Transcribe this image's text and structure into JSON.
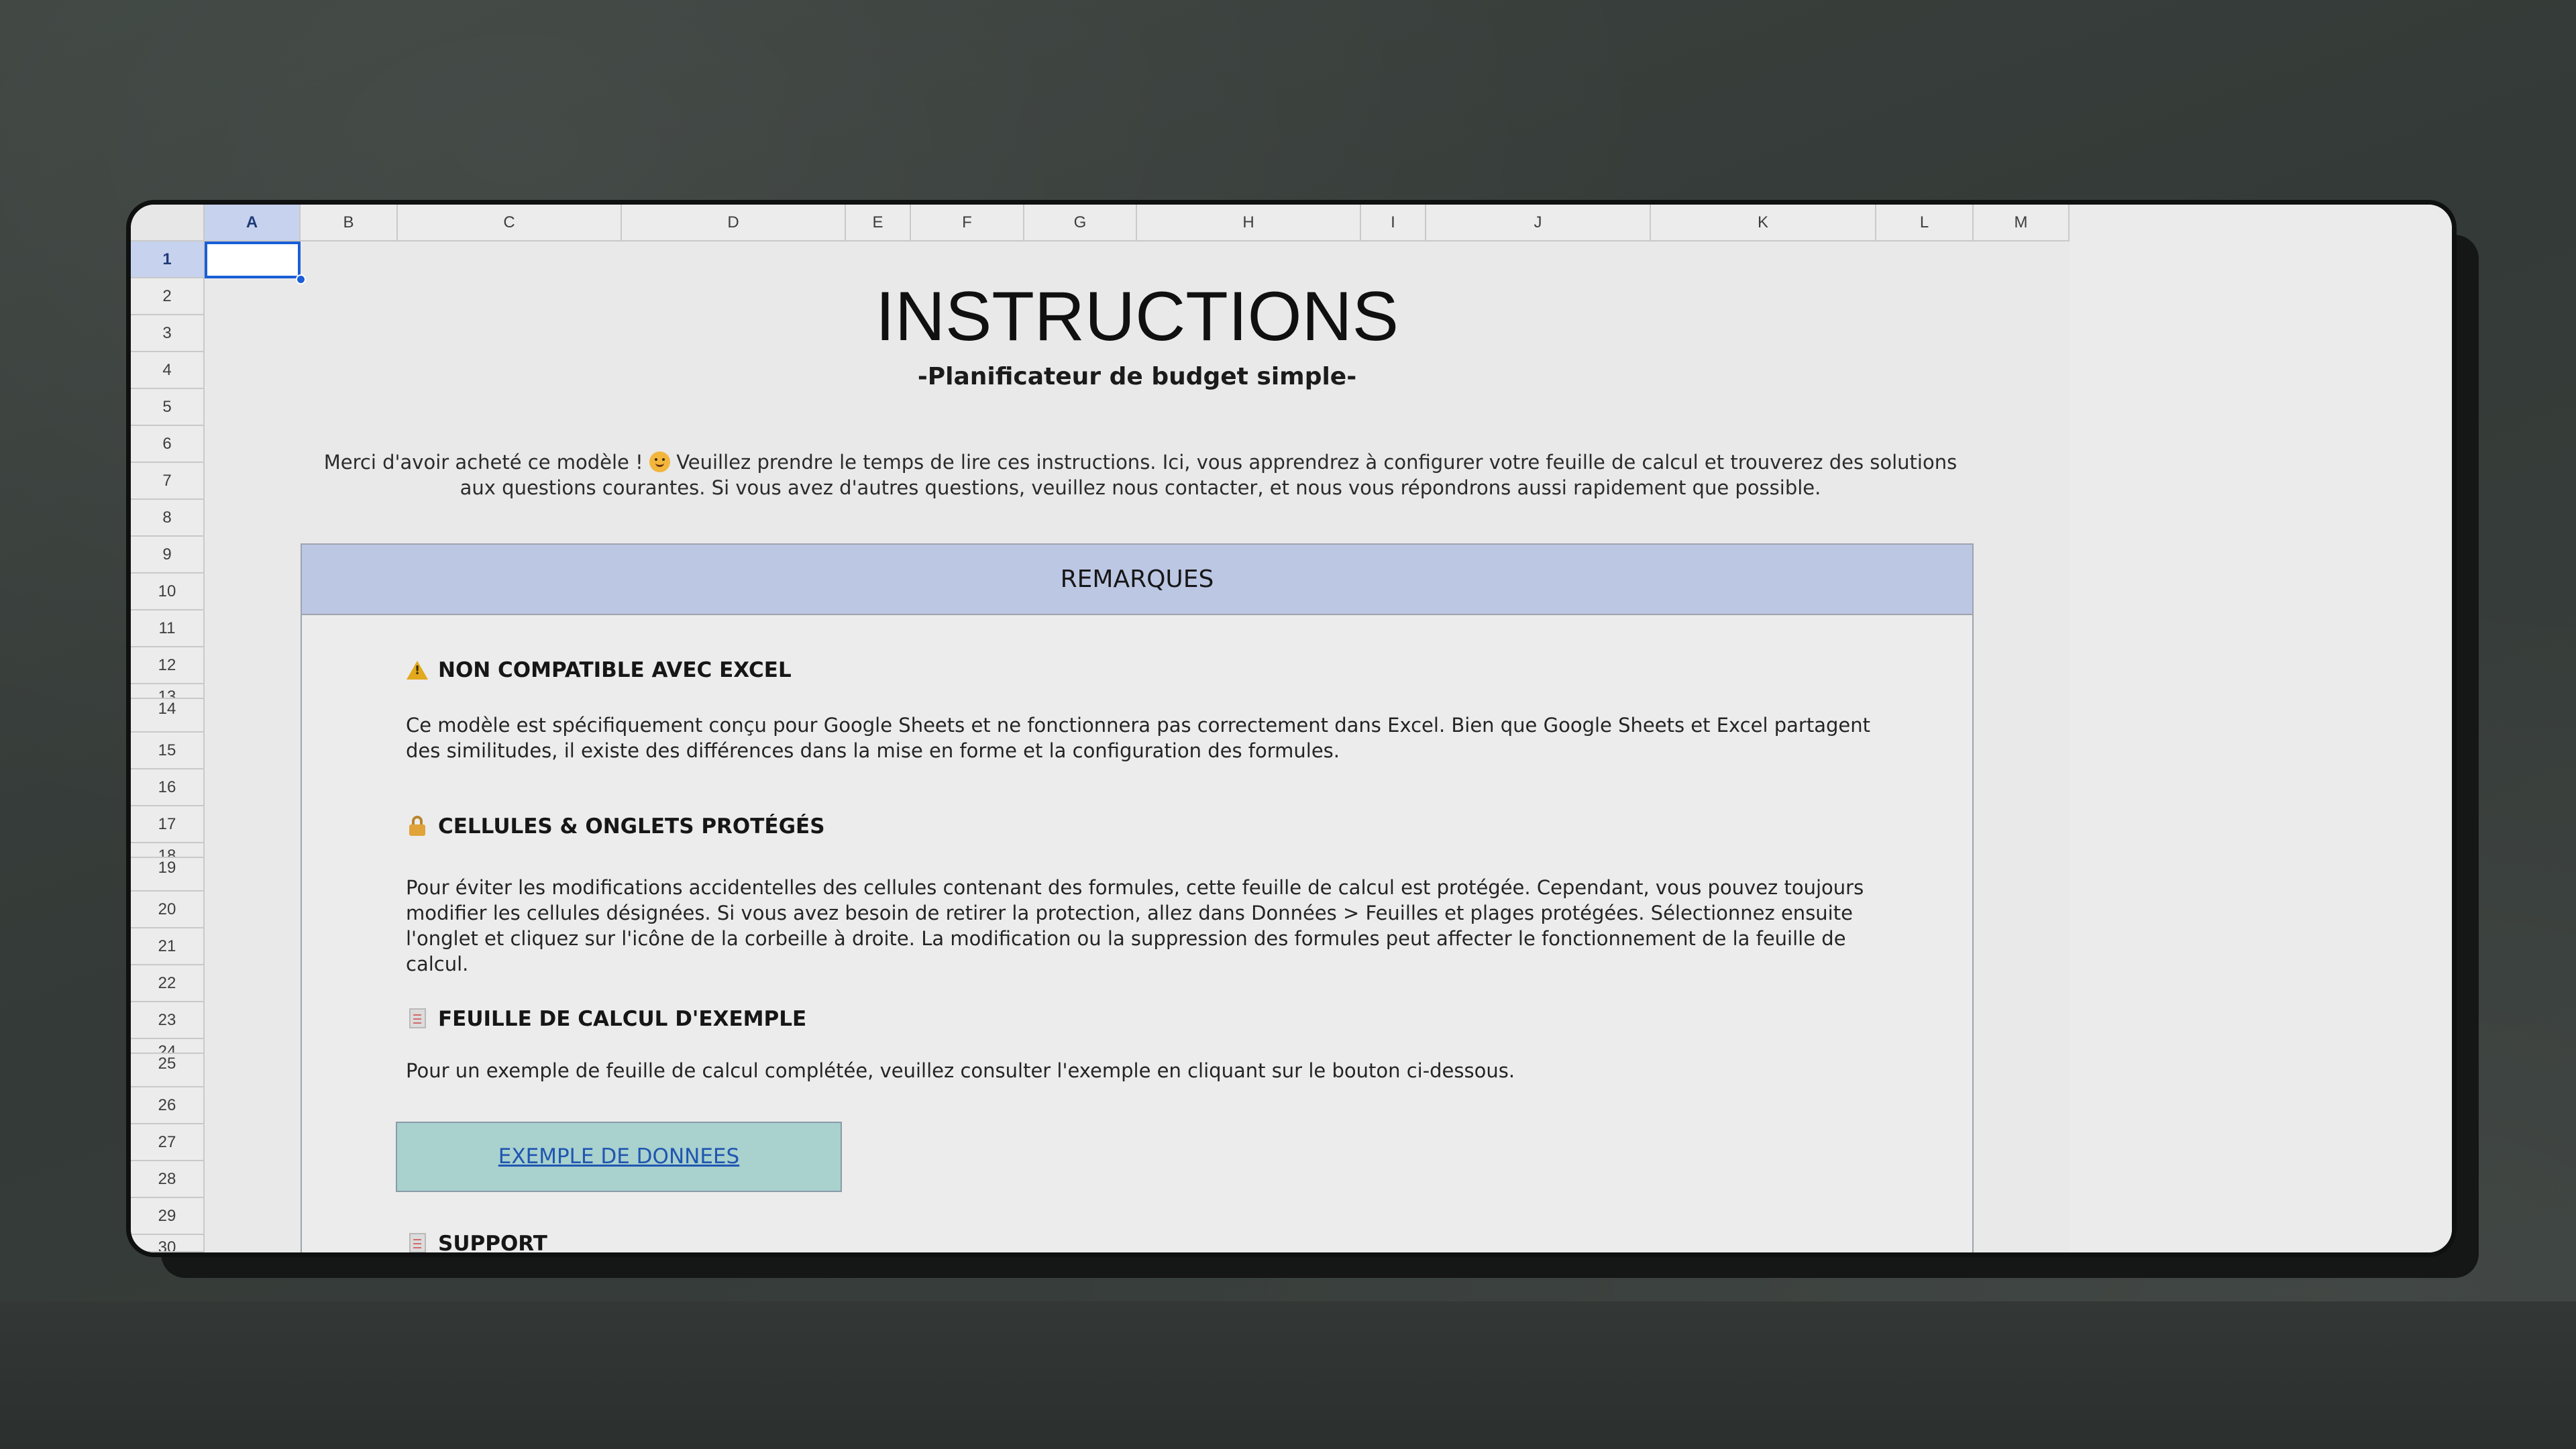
{
  "spreadsheet": {
    "selected_cell": "A1",
    "columns": [
      "A",
      "B",
      "C",
      "D",
      "E",
      "F",
      "G",
      "H",
      "I",
      "J",
      "K",
      "L",
      "M"
    ],
    "rows": [
      "1",
      "2",
      "3",
      "4",
      "5",
      "6",
      "7",
      "8",
      "9",
      "10",
      "11",
      "12",
      "13",
      "14",
      "15",
      "16",
      "17",
      "18",
      "19",
      "20",
      "21",
      "22",
      "23",
      "24",
      "25",
      "26",
      "27",
      "28",
      "29",
      "30"
    ]
  },
  "document": {
    "title": "INSTRUCTIONS",
    "subtitle": "-Planificateur de budget simple-",
    "intro_before_emoji": "Merci d'avoir acheté ce modèle !",
    "intro_after_emoji": "Veuillez prendre le temps de lire ces instructions. Ici, vous apprendrez à configurer votre feuille de calcul et trouverez des solutions aux questions courantes. Si vous avez d'autres questions, veuillez nous contacter, et nous vous répondrons aussi rapidement que possible.",
    "remarks_header": "REMARQUES",
    "sections": [
      {
        "title": "NON COMPATIBLE AVEC EXCEL",
        "body": "Ce modèle est spécifiquement conçu pour Google Sheets et ne fonctionnera pas correctement dans Excel. Bien que Google Sheets et Excel partagent des similitudes, il existe des différences dans la mise en forme et la configuration des formules."
      },
      {
        "title": "CELLULES & ONGLETS PROTÉGÉS",
        "body": "Pour éviter les modifications accidentelles des cellules contenant des formules, cette feuille de calcul est protégée. Cependant, vous pouvez toujours modifier les cellules désignées. Si vous avez besoin de retirer la protection, allez dans Données > Feuilles et plages protégées. Sélectionnez ensuite l'onglet et cliquez sur l'icône de la corbeille à droite. La modification ou la suppression des formules peut affecter le fonctionnement de la feuille de calcul."
      },
      {
        "title": "FEUILLE DE CALCUL D'EXEMPLE",
        "body": "Pour un exemple de feuille de calcul complétée, veuillez consulter l'exemple en cliquant sur le bouton ci-dessous."
      },
      {
        "title": "SUPPORT"
      }
    ],
    "example_button": "EXEMPLE DE DONNEES"
  },
  "icons": {
    "section_1": "warning-icon",
    "section_2": "lock-icon",
    "section_3": "document-icon",
    "section_4": "document-icon",
    "intro": "smiling-face-icon"
  },
  "colors": {
    "remarks_header": "#bcc7e4",
    "selected_header": "#c7d3ee",
    "selection": "#1a5ed8",
    "example_button": "#a9d1ce",
    "example_link": "#1f56b0"
  }
}
